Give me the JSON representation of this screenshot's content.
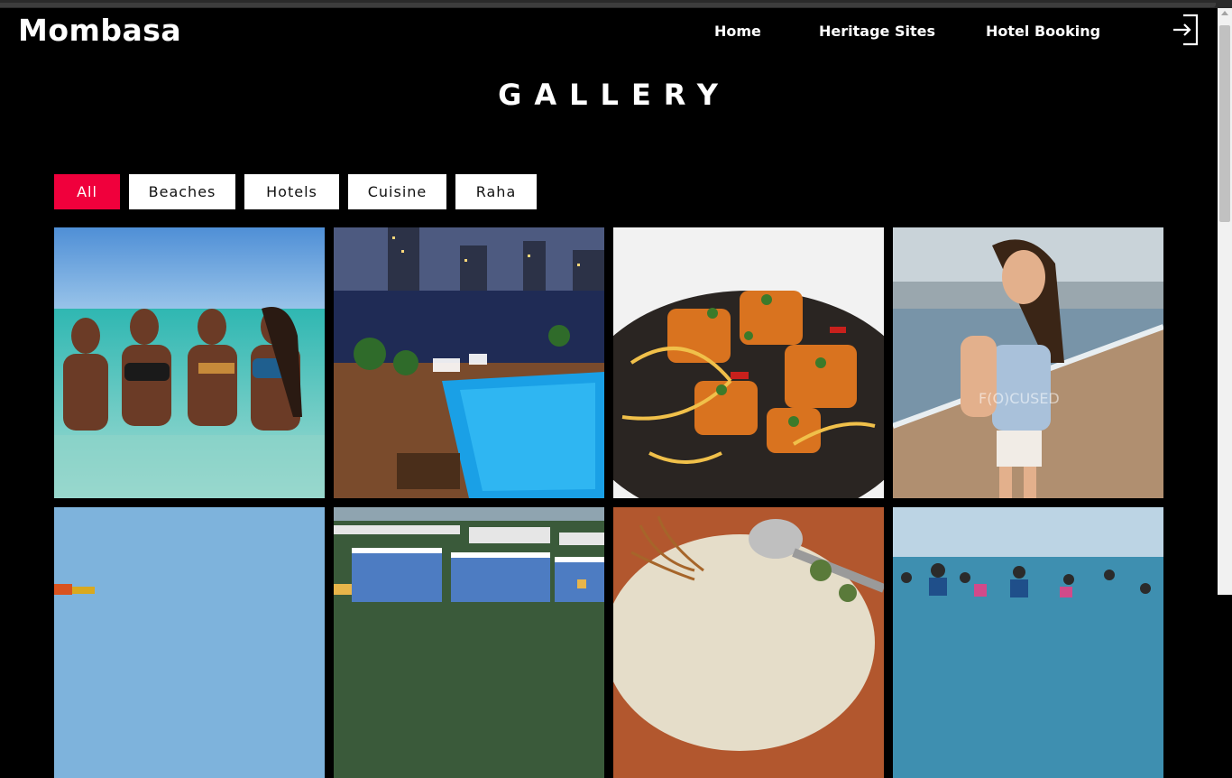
{
  "header": {
    "logo": "Mombasa",
    "nav": [
      "Home",
      "Heritage Sites",
      "Hotel Booking"
    ],
    "login_icon": "sign-in-icon"
  },
  "gallery": {
    "title": "GALLERY",
    "filters": [
      {
        "label": "All",
        "active": true
      },
      {
        "label": "Beaches",
        "active": false
      },
      {
        "label": "Hotels",
        "active": false
      },
      {
        "label": "Cuisine",
        "active": false
      },
      {
        "label": "Raha",
        "active": false
      }
    ],
    "watermark": "F(O)CUSED"
  },
  "colors": {
    "background": "#000000",
    "accent": "#f0003c",
    "filter_bg": "#ffffff"
  }
}
